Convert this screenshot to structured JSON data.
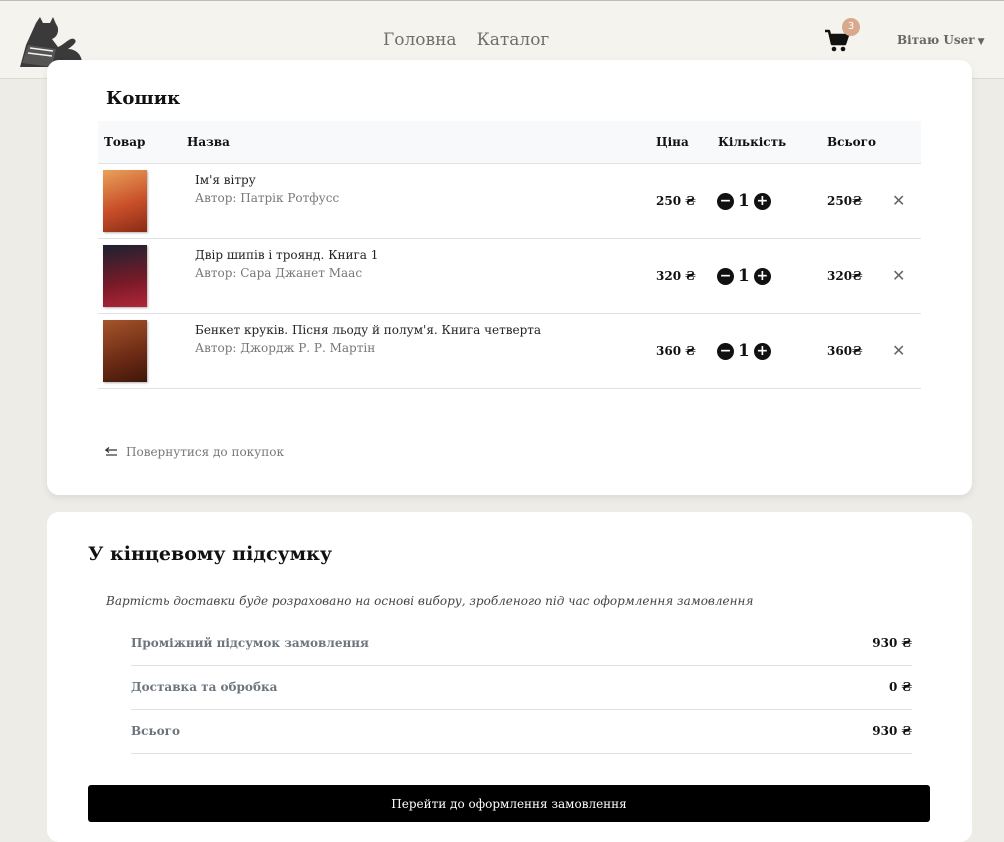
{
  "nav": {
    "links": [
      "Головна",
      "Каталог"
    ],
    "cart_count": "3",
    "user_greeting": "Вітаю User"
  },
  "cart": {
    "title": "Кошик",
    "headers": {
      "product": "Товар",
      "name": "Назва",
      "price": "Ціна",
      "quantity": "Кількість",
      "total": "Всього"
    },
    "items": [
      {
        "title": "Ім'я вітру",
        "author": "Автор: Патрік Ротфусс",
        "price": "250 ₴",
        "quantity": "1",
        "total": "250₴",
        "cover_colors": [
          "#c9502a",
          "#e9a25a"
        ]
      },
      {
        "title": "Двір шипів і троянд. Книга 1",
        "author": "Автор: Сара Джанет Маас",
        "price": "320 ₴",
        "quantity": "1",
        "total": "320₴",
        "cover_colors": [
          "#1c2230",
          "#b0263a"
        ]
      },
      {
        "title": "Бенкет круків. Пісня льоду й полум'я. Книга четверта",
        "author": "Автор: Джордж Р. Р. Мартін",
        "price": "360 ₴",
        "quantity": "1",
        "total": "360₴",
        "cover_colors": [
          "#6b2a14",
          "#a5552a"
        ]
      }
    ],
    "back_label": "Повернутися до покупок"
  },
  "summary": {
    "title": "У кінцевому підсумку",
    "note": "Вартість доставки буде розраховано на основі вибору, зробленого під час оформлення замовлення",
    "rows": [
      {
        "label": "Проміжний підсумок замовлення",
        "value": "930 ₴"
      },
      {
        "label": "Доставка та обробка",
        "value": "0 ₴"
      },
      {
        "label": "Всього",
        "value": "930 ₴"
      }
    ],
    "checkout_label": "Перейти до оформлення замовлення"
  },
  "colors": {
    "badge": "#d9a98b",
    "background": "#eeece7",
    "button": "#000000"
  }
}
